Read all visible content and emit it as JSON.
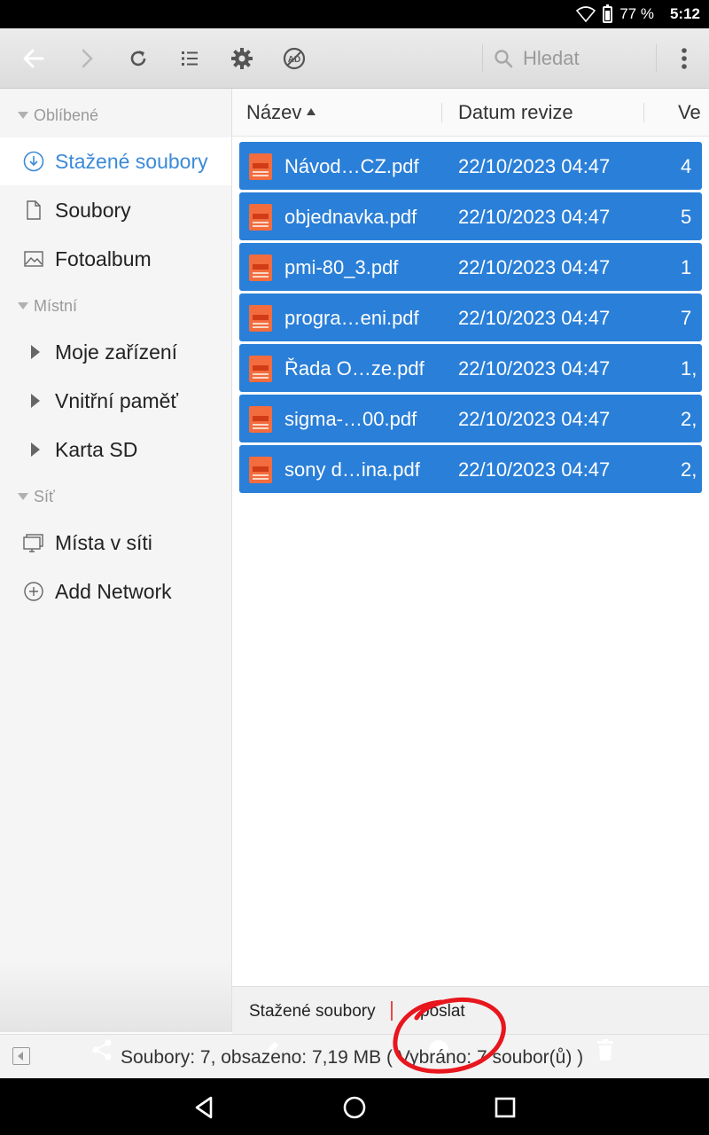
{
  "status": {
    "battery": "77 %",
    "time": "5:12"
  },
  "toolbar": {
    "back_icon": "arrow-left-icon",
    "forward_icon": "arrow-right-icon",
    "refresh_icon": "refresh-icon",
    "list_icon": "list-view-icon",
    "settings_icon": "gear-icon",
    "ad_icon": "ad-block-icon",
    "search_placeholder": "Hledat",
    "menu_icon": "more-vert-icon"
  },
  "sidebar": {
    "sections": [
      {
        "label": "Oblíbené"
      },
      {
        "label": "Místní"
      },
      {
        "label": "Síť"
      }
    ],
    "items": [
      {
        "label": "Stažené soubory",
        "icon": "download-icon",
        "active": true
      },
      {
        "label": "Soubory",
        "icon": "file-icon"
      },
      {
        "label": "Fotoalbum",
        "icon": "image-icon"
      },
      {
        "label": "Moje zařízení",
        "icon": "expand-arrow-icon"
      },
      {
        "label": "Vnitřní paměť",
        "icon": "expand-arrow-icon"
      },
      {
        "label": "Karta SD",
        "icon": "expand-arrow-icon"
      },
      {
        "label": "Místa v síti",
        "icon": "monitor-icon"
      },
      {
        "label": "Add Network",
        "icon": "add-circle-icon"
      }
    ]
  },
  "columns": {
    "name": "Název",
    "date": "Datum revize",
    "size": "Ve"
  },
  "files": [
    {
      "name": "Návod…CZ.pdf",
      "date": "22/10/2023 04:47",
      "size": "4"
    },
    {
      "name": "objednavka.pdf",
      "date": "22/10/2023 04:47",
      "size": "5"
    },
    {
      "name": "pmi-80_3.pdf",
      "date": "22/10/2023 04:47",
      "size": "1"
    },
    {
      "name": "progra…eni.pdf",
      "date": "22/10/2023 04:47",
      "size": "7"
    },
    {
      "name": "Řada O…ze.pdf",
      "date": "22/10/2023 04:47",
      "size": "1,"
    },
    {
      "name": "sigma-…00.pdf",
      "date": "22/10/2023 04:47",
      "size": "2,"
    },
    {
      "name": "sony d…ina.pdf",
      "date": "22/10/2023 04:47",
      "size": "2,"
    }
  ],
  "breadcrumb": {
    "current": "Stažené soubory",
    "action": "poslat"
  },
  "footer": {
    "summary": "Soubory: 7, obsazeno: 7,19 MB ( Vybráno: 7 soubor(ů) )"
  },
  "colors": {
    "accent": "#3b8ad8",
    "selection": "#2a7fd8",
    "annotation": "#e8161d"
  }
}
